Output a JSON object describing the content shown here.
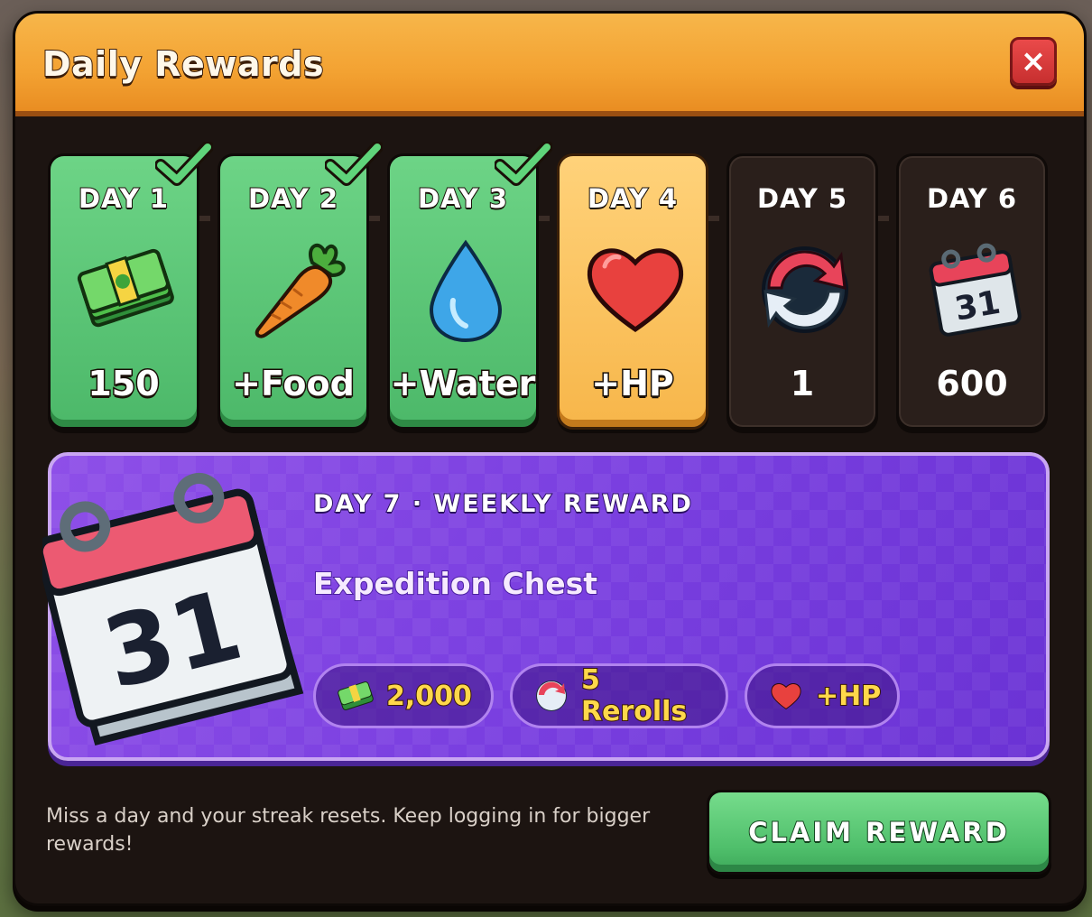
{
  "window": {
    "title": "Daily Rewards",
    "close_icon": "×"
  },
  "days": [
    {
      "label": "DAY 1",
      "value": "150",
      "icon": "cash-icon",
      "state": "claimed"
    },
    {
      "label": "DAY 2",
      "value": "+Food",
      "icon": "carrot-icon",
      "state": "claimed"
    },
    {
      "label": "DAY 3",
      "value": "+Water",
      "icon": "water-drop-icon",
      "state": "claimed"
    },
    {
      "label": "DAY 4",
      "value": "+HP",
      "icon": "heart-icon",
      "state": "current"
    },
    {
      "label": "DAY 5",
      "value": "1",
      "icon": "reroll-icon",
      "state": "locked"
    },
    {
      "label": "DAY 6",
      "value": "600",
      "icon": "calendar-icon",
      "state": "locked"
    }
  ],
  "weekly": {
    "kicker": "DAY 7 · WEEKLY REWARD",
    "name": "Expedition Chest",
    "calendar_number": "31",
    "rewards": [
      {
        "label": "2,000",
        "icon": "cash-icon"
      },
      {
        "label": "5 Rerolls",
        "icon": "reroll-icon"
      },
      {
        "label": "+HP",
        "icon": "heart-icon"
      }
    ]
  },
  "footer": {
    "note": "Miss a day and your streak resets. Keep logging in for bigger rewards!",
    "claim_label": "CLAIM REWARD"
  },
  "colors": {
    "header": "#f3a232",
    "claimed": "#4cb869",
    "current": "#f7b64a",
    "locked": "#2a1f1b",
    "weekly": "#7a3fe0",
    "claim_button": "#4fbf6b"
  }
}
